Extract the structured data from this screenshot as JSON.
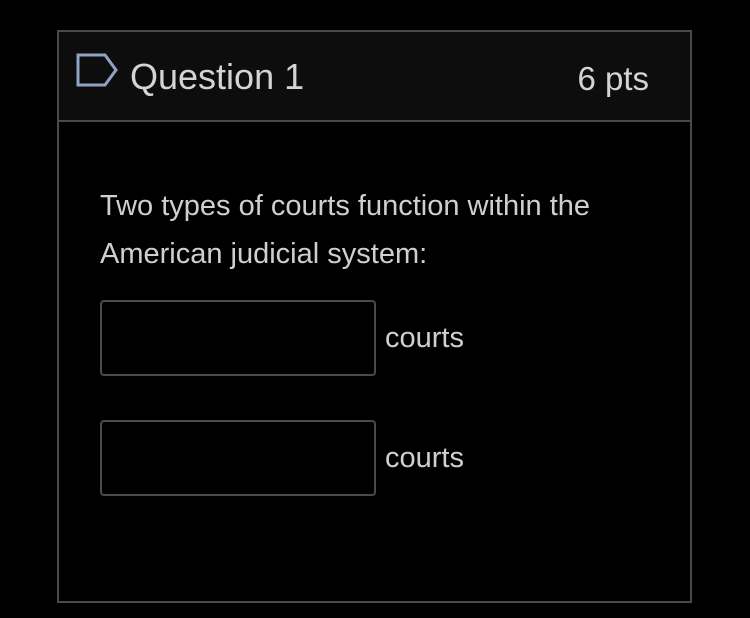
{
  "question": {
    "flag_icon": "flag-outline-icon",
    "title": "Question 1",
    "points": "6 pts",
    "text": "Two types of courts function within the American judicial system:",
    "blanks": [
      {
        "value": "",
        "suffix": "courts"
      },
      {
        "value": "",
        "suffix": "courts"
      }
    ]
  },
  "colors": {
    "background": "#000000",
    "header_background": "#0d0d0d",
    "border": "#4a4a4a",
    "text": "#d4d4d4",
    "flag": "#8fa3c2"
  }
}
